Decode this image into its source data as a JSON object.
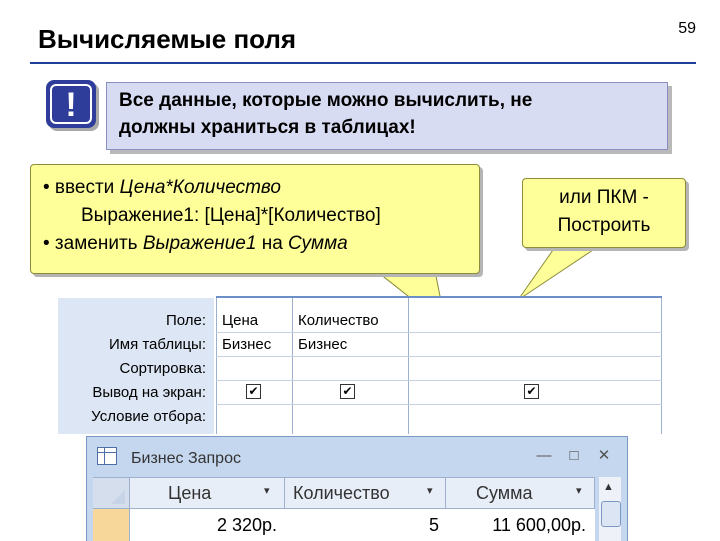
{
  "slide": {
    "title": "Вычисляемые поля",
    "page_number": "59"
  },
  "note": {
    "icon": "exclamation-icon",
    "icon_glyph": "!",
    "line1": "Все данные, которые можно вычислить, не",
    "line2": "должны храниться в таблицах!"
  },
  "callout_left": {
    "row1_prefix": "• ввести ",
    "row1_italic": "Цена*Количество",
    "row2": "Выражение1: [Цена]*[Количество]",
    "row3_prefix": "• заменить ",
    "row3_italic1": "Выражение1",
    "row3_mid": " на ",
    "row3_italic2": "Сумма"
  },
  "callout_right": {
    "line1": "или ПКМ -",
    "line2": "Построить"
  },
  "query_grid": {
    "row_labels": [
      "Поле:",
      "Имя таблицы:",
      "Сортировка:",
      "Вывод на экран:",
      "Условие отбора:"
    ],
    "columns": [
      {
        "field": "Цена",
        "table": "Бизнес",
        "show": true
      },
      {
        "field": "Количество",
        "table": "Бизнес",
        "show": true
      },
      {
        "field": "",
        "table": "",
        "show": true
      }
    ],
    "check_glyph": "✔"
  },
  "result_window": {
    "title": "Бизнес Запрос",
    "minimize": "—",
    "maximize": "□",
    "close": "✕",
    "headers": [
      "Цена",
      "Количество",
      "Сумма"
    ],
    "sort_arrow": "▾",
    "row": [
      "2 320р.",
      "5",
      "11 600,00р."
    ],
    "scroll_up": "▲"
  },
  "colors": {
    "title_rule": "#1f3f99",
    "note_bg": "#d8dcf3",
    "callout_bg": "#ffff99",
    "grid_label_bg": "#dce6f4",
    "window_bg": "#c5d7ee"
  }
}
